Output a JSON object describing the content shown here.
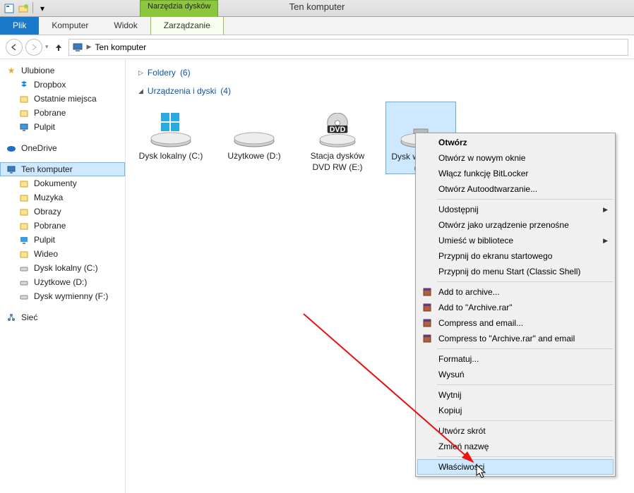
{
  "window": {
    "title": "Ten komputer"
  },
  "ribbon": {
    "contextual_header": "Narzędzia dysków",
    "file_tab": "Plik",
    "tabs": [
      "Komputer",
      "Widok",
      "Zarządzanie"
    ]
  },
  "address": {
    "root": "Ten komputer"
  },
  "sidebar": {
    "favorites": {
      "label": "Ulubione",
      "items": [
        "Dropbox",
        "Ostatnie miejsca",
        "Pobrane",
        "Pulpit"
      ]
    },
    "onedrive": "OneDrive",
    "thispc": {
      "label": "Ten komputer",
      "items": [
        "Dokumenty",
        "Muzyka",
        "Obrazy",
        "Pobrane",
        "Pulpit",
        "Wideo",
        "Dysk lokalny (C:)",
        "Użytkowe (D:)",
        "Dysk wymienny (F:)"
      ]
    },
    "network": "Sieć"
  },
  "groups": {
    "folders": {
      "label": "Foldery",
      "count": "(6)"
    },
    "drives": {
      "label": "Urządzenia i dyski",
      "count": "(4)"
    }
  },
  "drives": [
    {
      "label": "Dysk lokalny (C:)"
    },
    {
      "label": "Użytkowe (D:)"
    },
    {
      "label": "Stacja dysków DVD RW (E:)"
    },
    {
      "label": "Dysk wymienny (F:)"
    }
  ],
  "context_menu": {
    "open": "Otwórz",
    "open_new_window": "Otwórz w nowym oknie",
    "bitlocker": "Włącz funkcję BitLocker",
    "autoplay": "Otwórz Autoodtwarzanie...",
    "share": "Udostępnij",
    "portable": "Otwórz jako urządzenie przenośne",
    "library": "Umieść w bibliotece",
    "pin_start": "Przypnij do ekranu startowego",
    "pin_classic": "Przypnij do menu Start (Classic Shell)",
    "add_archive": "Add to archive...",
    "add_rar": "Add to \"Archive.rar\"",
    "compress_email": "Compress and email...",
    "compress_rar_email": "Compress to \"Archive.rar\" and email",
    "format": "Formatuj...",
    "eject": "Wysuń",
    "cut": "Wytnij",
    "copy": "Kopiuj",
    "shortcut": "Utwórz skrót",
    "rename": "Zmień nazwę",
    "properties": "Właściwości"
  }
}
